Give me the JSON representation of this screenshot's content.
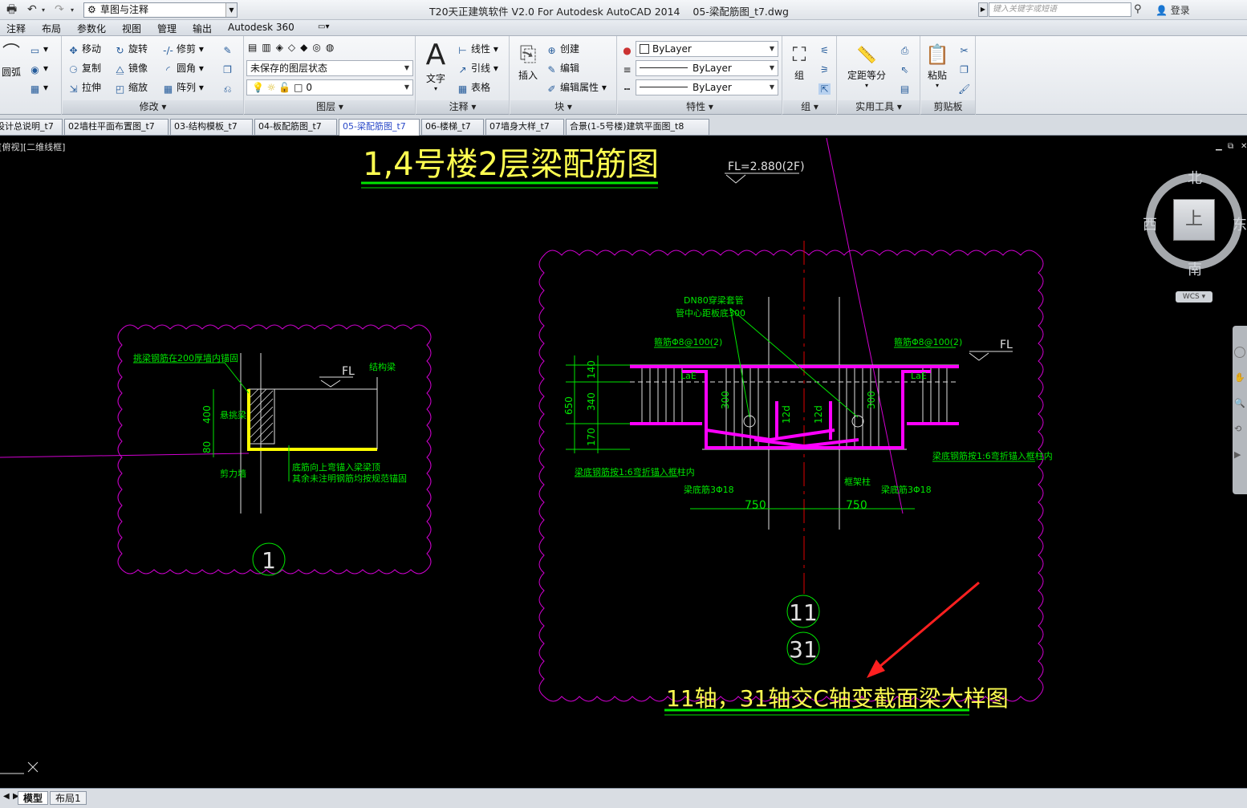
{
  "titlebar": {
    "workspace": "草图与注释",
    "app_title": "T20天正建筑软件 V2.0 For Autodesk AutoCAD 2014    05-梁配筋图_t7.dwg",
    "search_placeholder": "键入关键字或短语",
    "login": "登录"
  },
  "menu": [
    "注释",
    "布局",
    "参数化",
    "视图",
    "管理",
    "输出",
    "Autodesk 360"
  ],
  "ribbon": {
    "modify": {
      "label": "修改",
      "arc": "圆弧",
      "move": "移动",
      "rotate": "旋转",
      "trim": "修剪",
      "copy": "复制",
      "mirror": "镜像",
      "fillet": "圆角",
      "stretch": "拉伸",
      "scale": "缩放",
      "array": "阵列"
    },
    "layers": {
      "label": "图层",
      "state": "未保存的图层状态",
      "current": "0"
    },
    "annotation": {
      "label": "注释",
      "text": "文字",
      "linear": "线性",
      "leader": "引线",
      "table": "表格"
    },
    "block": {
      "label": "块",
      "insert": "插入",
      "create": "创建",
      "edit": "编辑",
      "edit_attr": "编辑属性"
    },
    "properties": {
      "label": "特性",
      "color": "ByLayer",
      "linetype": "ByLayer",
      "lineweight": "ByLayer"
    },
    "groups": {
      "label": "组",
      "group": "组"
    },
    "utilities": {
      "label": "实用工具",
      "measure": "定距等分"
    },
    "clipboard": {
      "label": "剪贴板",
      "paste": "粘贴"
    }
  },
  "tabs": [
    "设计总说明_t7",
    "02墙柱平面布置图_t7",
    "03-结构模板_t7",
    "04-板配筋图_t7",
    "05-梁配筋图_t7",
    "06-楼梯_t7",
    "07墙身大样_t7",
    "合景(1-5号楼)建筑平面图_t8"
  ],
  "active_tab": "05-梁配筋图_t7",
  "viewport": {
    "label": "-][俯视][二维线框]"
  },
  "viewcube": {
    "north": "北",
    "south": "南",
    "east": "东",
    "west": "西",
    "top": "上",
    "wcs": "WCS"
  },
  "drawing": {
    "main_title": "1,4号楼2层梁配筋图",
    "fl_level": "FL=2.880(2F)",
    "detail1": {
      "note_top": "挑梁钢筋在200厚墙内锚固",
      "structure_beam": "结构梁",
      "fl": "FL",
      "dim_400": "400",
      "dim_80": "80",
      "cantilever": "悬挑梁",
      "shear_wall": "剪力墙",
      "note_bottom1": "底筋向上弯锚入梁梁顶",
      "note_bottom2": "其余未注明钢筋均按规范锚固",
      "number": "1"
    },
    "detail2": {
      "pipe1": "DN80穿梁套管",
      "pipe2": "管中心距板底300",
      "stirrup_left": "箍筋Φ8@100(2)",
      "stirrup_right": "箍筋Φ8@100(2)",
      "fl": "FL",
      "dim_650": "650",
      "dim_140": "140",
      "dim_340": "340",
      "dim_170": "170",
      "dim_300a": "300",
      "dim_300b": "300",
      "dim_12d_a": "12d",
      "dim_12d_b": "12d",
      "lae_left": "LaE",
      "lae_right": "LaE",
      "note_left": "梁底钢筋按1:6弯折锚入框柱内",
      "note_right": "梁底钢筋按1:6弯折锚入框柱内",
      "extra_left": "梁底筋3Φ18",
      "extra_right": "梁底筋3Φ18",
      "column": "框架柱",
      "dim_750a": "750",
      "dim_750b": "750",
      "axis1": "11",
      "axis2": "31",
      "caption": "11轴，31轴交C轴变截面梁大样图"
    }
  },
  "status": {
    "model": "模型",
    "layout": "布局1"
  }
}
